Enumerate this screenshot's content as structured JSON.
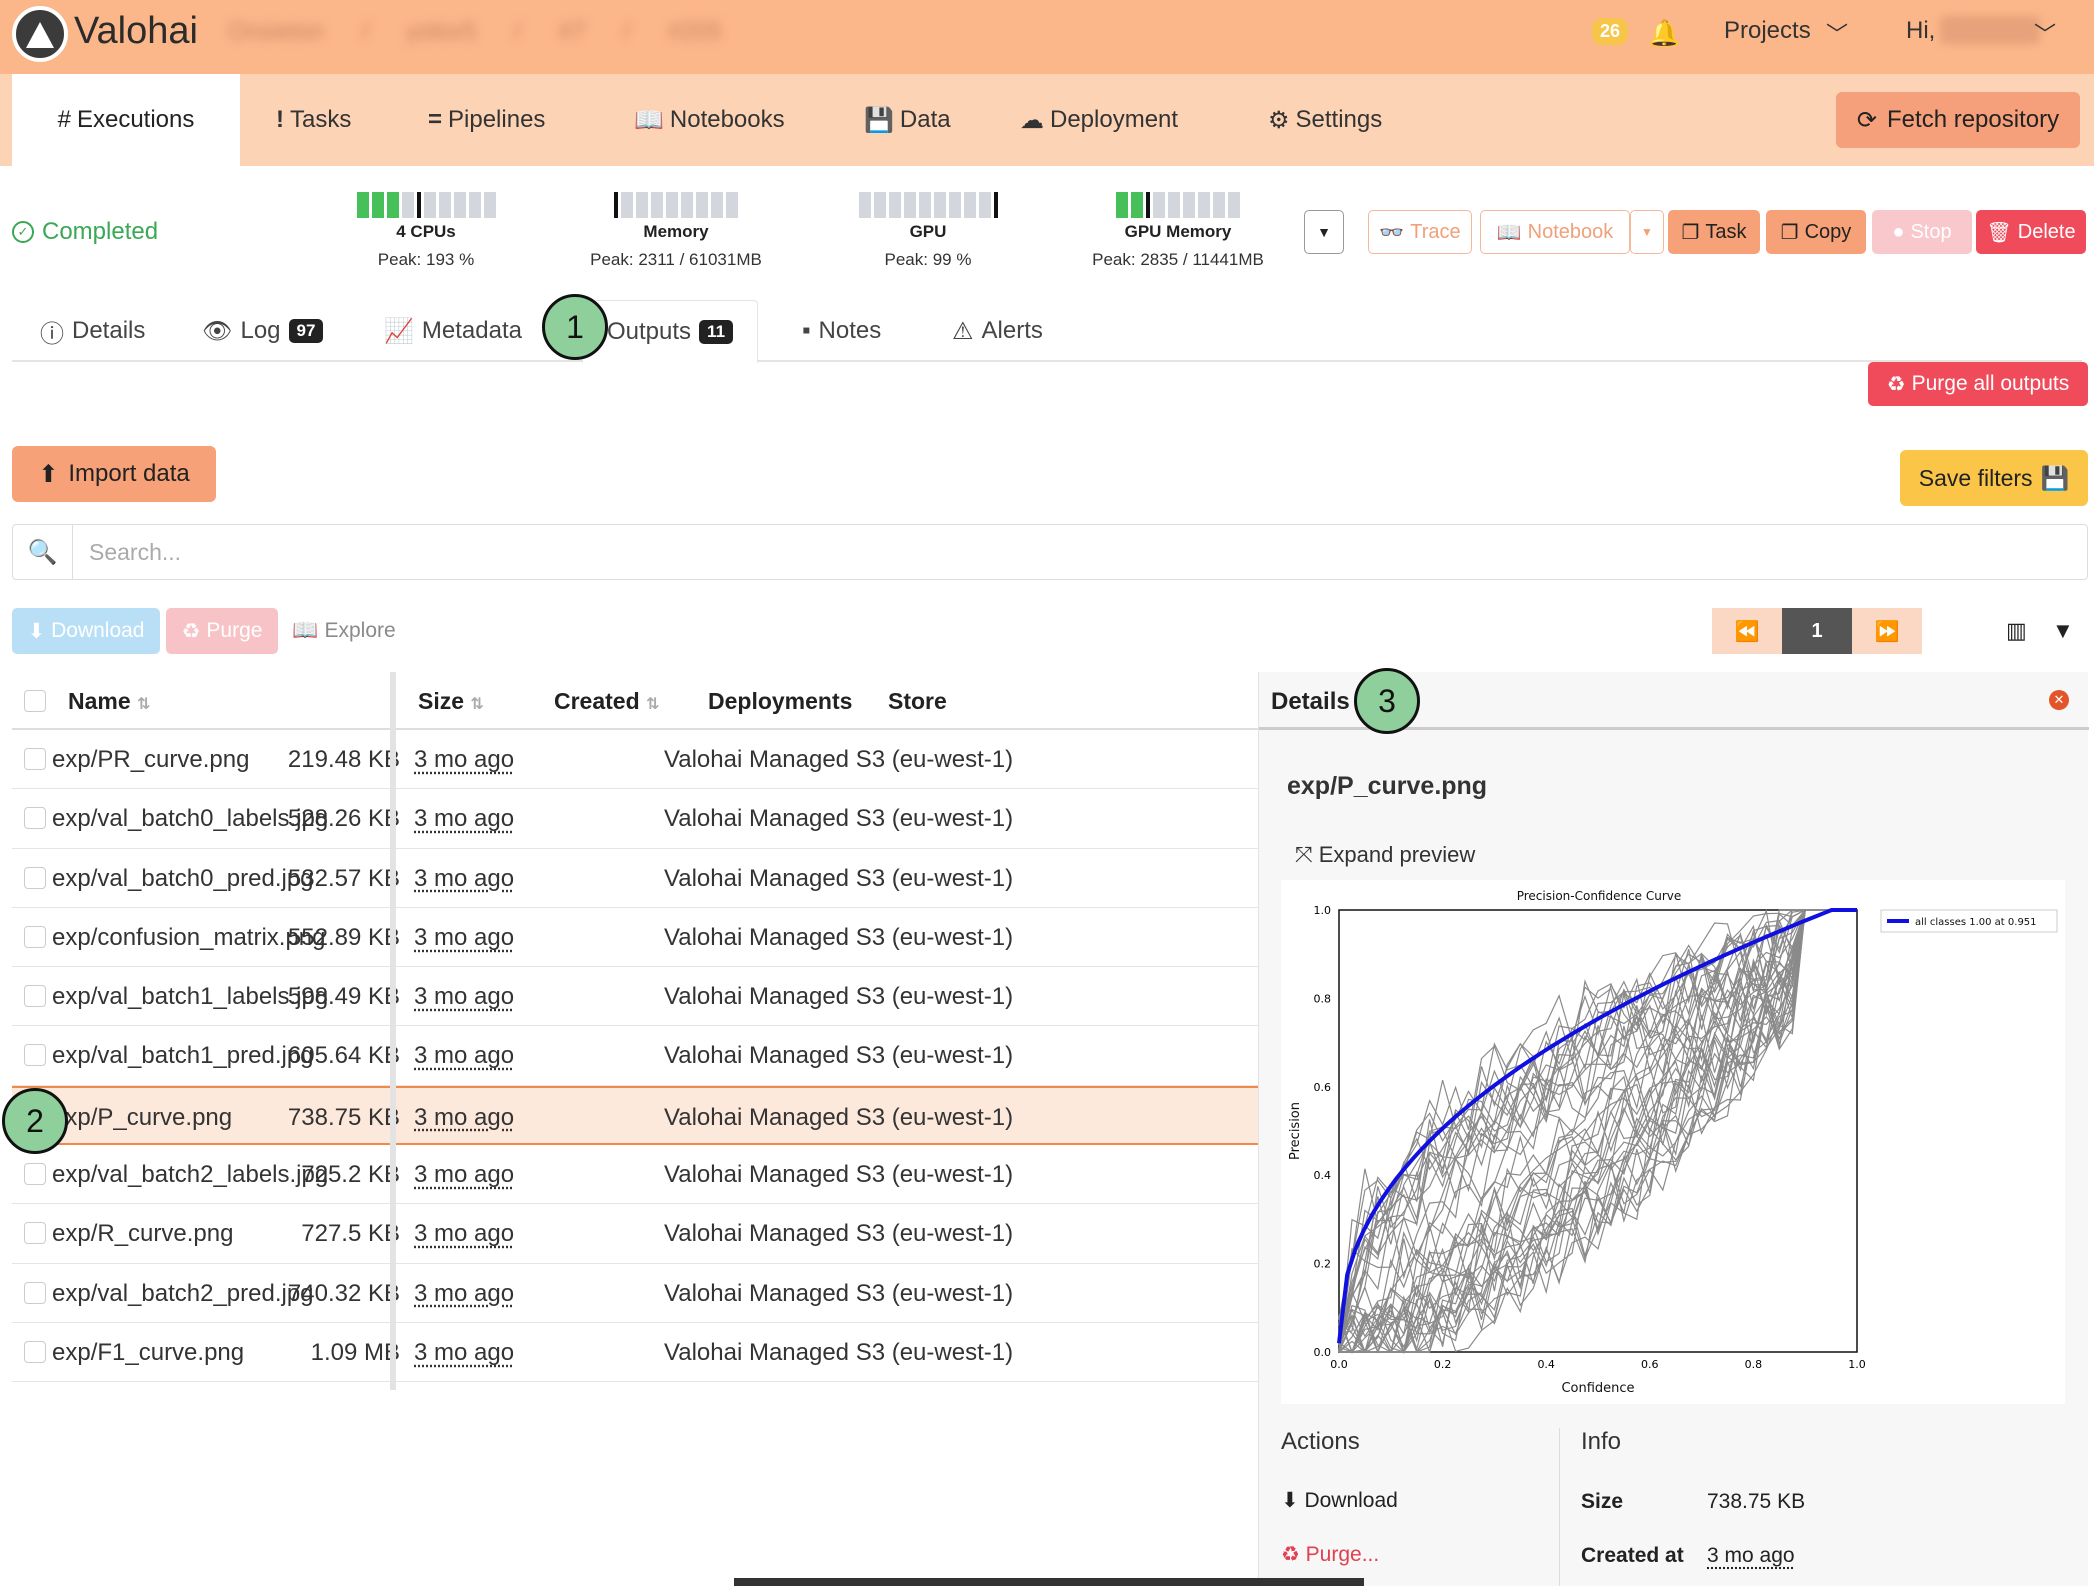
{
  "app": {
    "brand": "Valohai",
    "notifications": "26",
    "projects_label": "Projects",
    "greeting": "Hi,"
  },
  "breadcrumbs": [
    "Onsieton",
    "yolov5",
    "#7",
    "#205"
  ],
  "nav": {
    "tabs": [
      {
        "label": "Executions",
        "icon": "hash-icon"
      },
      {
        "label": "Tasks",
        "icon": "exclamation-icon"
      },
      {
        "label": "Pipelines",
        "icon": "equals-icon"
      },
      {
        "label": "Notebooks",
        "icon": "book-icon"
      },
      {
        "label": "Data",
        "icon": "floppy-icon"
      },
      {
        "label": "Deployment",
        "icon": "cloud-icon"
      },
      {
        "label": "Settings",
        "icon": "gear-icon"
      }
    ],
    "fetch_label": "Fetch repository"
  },
  "execution": {
    "status": "Completed",
    "meters": [
      {
        "name": "4 CPUs",
        "peak": "Peak: 193 %"
      },
      {
        "name": "Memory",
        "peak": "Peak: 2311 / 61031MB"
      },
      {
        "name": "GPU",
        "peak": "Peak: 99 %"
      },
      {
        "name": "GPU Memory",
        "peak": "Peak: 2835 / 11441MB"
      }
    ],
    "actions": {
      "trace": "Trace",
      "notebook": "Notebook",
      "task": "Task",
      "copy": "Copy",
      "stop": "Stop",
      "delete": "Delete"
    }
  },
  "subtabs": {
    "details": "Details",
    "log": "Log",
    "log_count": "97",
    "metadata": "Metadata",
    "outputs": "Outputs",
    "outputs_count": "11",
    "notes": "Notes",
    "alerts": "Alerts"
  },
  "markers": [
    "1",
    "2",
    "3"
  ],
  "outputs": {
    "purge_all": "Purge all outputs",
    "import": "Import data",
    "save_filters": "Save filters",
    "search_placeholder": "Search...",
    "toolbar": {
      "download": "Download",
      "purge": "Purge",
      "explore": "Explore"
    },
    "page": "1",
    "columns": {
      "name": "Name",
      "size": "Size",
      "created": "Created",
      "deployments": "Deployments",
      "store": "Store"
    },
    "rows": [
      {
        "name": "exp/PR_curve.png",
        "size": "219.48 KB",
        "created": "3 mo ago",
        "store": "Valohai Managed S3 (eu-west-1)"
      },
      {
        "name": "exp/val_batch0_labels.jpg",
        "size": "528.26 KB",
        "created": "3 mo ago",
        "store": "Valohai Managed S3 (eu-west-1)"
      },
      {
        "name": "exp/val_batch0_pred.jpg",
        "size": "532.57 KB",
        "created": "3 mo ago",
        "store": "Valohai Managed S3 (eu-west-1)"
      },
      {
        "name": "exp/confusion_matrix.png",
        "size": "552.89 KB",
        "created": "3 mo ago",
        "store": "Valohai Managed S3 (eu-west-1)"
      },
      {
        "name": "exp/val_batch1_labels.jpg",
        "size": "598.49 KB",
        "created": "3 mo ago",
        "store": "Valohai Managed S3 (eu-west-1)"
      },
      {
        "name": "exp/val_batch1_pred.jpg",
        "size": "605.64 KB",
        "created": "3 mo ago",
        "store": "Valohai Managed S3 (eu-west-1)"
      },
      {
        "name": "exp/P_curve.png",
        "size": "738.75 KB",
        "created": "3 mo ago",
        "store": "Valohai Managed S3 (eu-west-1)"
      },
      {
        "name": "exp/val_batch2_labels.jpg",
        "size": "725.2 KB",
        "created": "3 mo ago",
        "store": "Valohai Managed S3 (eu-west-1)"
      },
      {
        "name": "exp/R_curve.png",
        "size": "727.5 KB",
        "created": "3 mo ago",
        "store": "Valohai Managed S3 (eu-west-1)"
      },
      {
        "name": "exp/val_batch2_pred.jpg",
        "size": "740.32 KB",
        "created": "3 mo ago",
        "store": "Valohai Managed S3 (eu-west-1)"
      },
      {
        "name": "exp/F1_curve.png",
        "size": "1.09 MB",
        "created": "3 mo ago",
        "store": "Valohai Managed S3 (eu-west-1)"
      }
    ]
  },
  "details": {
    "header": "Details",
    "filename": "exp/P_curve.png",
    "expand": "Expand preview",
    "preview_chart": {
      "title": "Precision-Confidence Curve",
      "xlabel": "Confidence",
      "ylabel": "Precision",
      "legend": "all classes 1.00 at 0.951",
      "ticks": [
        "0.0",
        "0.2",
        "0.4",
        "0.6",
        "0.8",
        "1.0"
      ]
    },
    "actions_header": "Actions",
    "download": "Download",
    "purge": "Purge...",
    "info_header": "Info",
    "size_label": "Size",
    "size_value": "738.75 KB",
    "created_label": "Created at",
    "created_value": "3 mo ago"
  },
  "colors": {
    "accent": "#fbb68a",
    "nav": "#fdd3b5",
    "orange_btn": "#f6a177",
    "danger": "#ef4b5b",
    "success": "#3aa856",
    "selected_row": "#fde9dc"
  }
}
